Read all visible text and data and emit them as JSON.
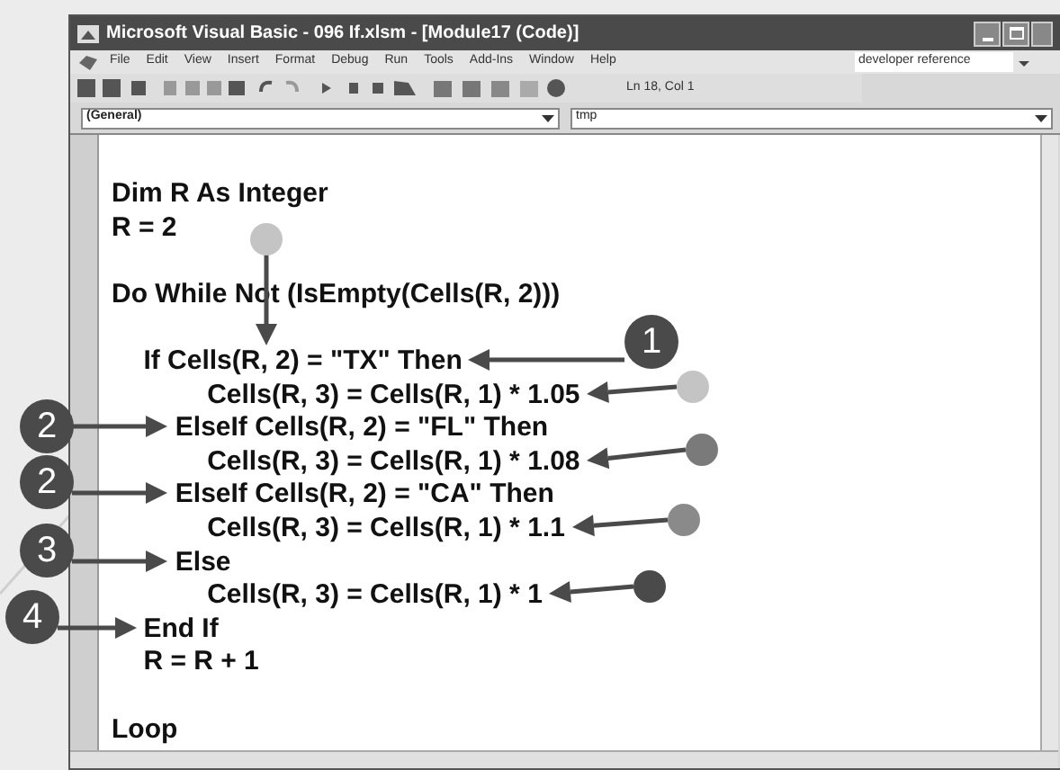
{
  "window": {
    "title": "Microsoft Visual Basic - 096 If.xlsm - [Module17 (Code)]"
  },
  "menu": [
    "File",
    "Edit",
    "View",
    "Insert",
    "Format",
    "Debug",
    "Run",
    "Tools",
    "Add-Ins",
    "Window",
    "Help"
  ],
  "help_search": {
    "value": "developer reference"
  },
  "toolbar": {
    "position": "Ln 18, Col 1"
  },
  "object_dropdown": {
    "value": "(General)"
  },
  "procedure_dropdown": {
    "value": "tmp"
  },
  "code": [
    {
      "text": "Dim R As Integer",
      "gap_before": false
    },
    {
      "text": "R = 2",
      "gap_before": false
    },
    {
      "text": "Do While Not (IsEmpty(Cells(R, 2)))",
      "gap_before": true,
      "children": [
        {
          "text": "If Cells(R, 2) = \"TX\" Then",
          "gap_before": true,
          "children": [
            {
              "text": "Cells(R, 3) = Cells(R, 1) * 1.05",
              "kind": "body"
            },
            {
              "text": "ElseIf Cells(R, 2) = \"FL\" Then",
              "kind": "branch"
            },
            {
              "text": "Cells(R, 3) = Cells(R, 1) * 1.08",
              "kind": "body"
            },
            {
              "text": "ElseIf Cells(R, 2) = \"CA\" Then",
              "kind": "branch"
            },
            {
              "text": "Cells(R, 3) = Cells(R, 1) * 1.1",
              "kind": "body"
            },
            {
              "text": "Else",
              "kind": "branch"
            },
            {
              "text": "Cells(R, 3) = Cells(R, 1) * 1",
              "kind": "body"
            }
          ]
        },
        {
          "text": "End If",
          "gap_before": false
        },
        {
          "text": "R = R + 1",
          "gap_before": false
        }
      ]
    },
    {
      "text": "Loop",
      "gap_before": true
    }
  ],
  "callouts": [
    {
      "label": "1"
    },
    {
      "label": "2"
    },
    {
      "label": "2"
    },
    {
      "label": "3"
    },
    {
      "label": "4"
    }
  ],
  "markers": [
    {
      "color": "#c4c4c4"
    },
    {
      "color": "#c4c4c4"
    },
    {
      "color": "#7a7a7a"
    },
    {
      "color": "#8a8a8a"
    },
    {
      "color": "#4a4a4a"
    }
  ]
}
